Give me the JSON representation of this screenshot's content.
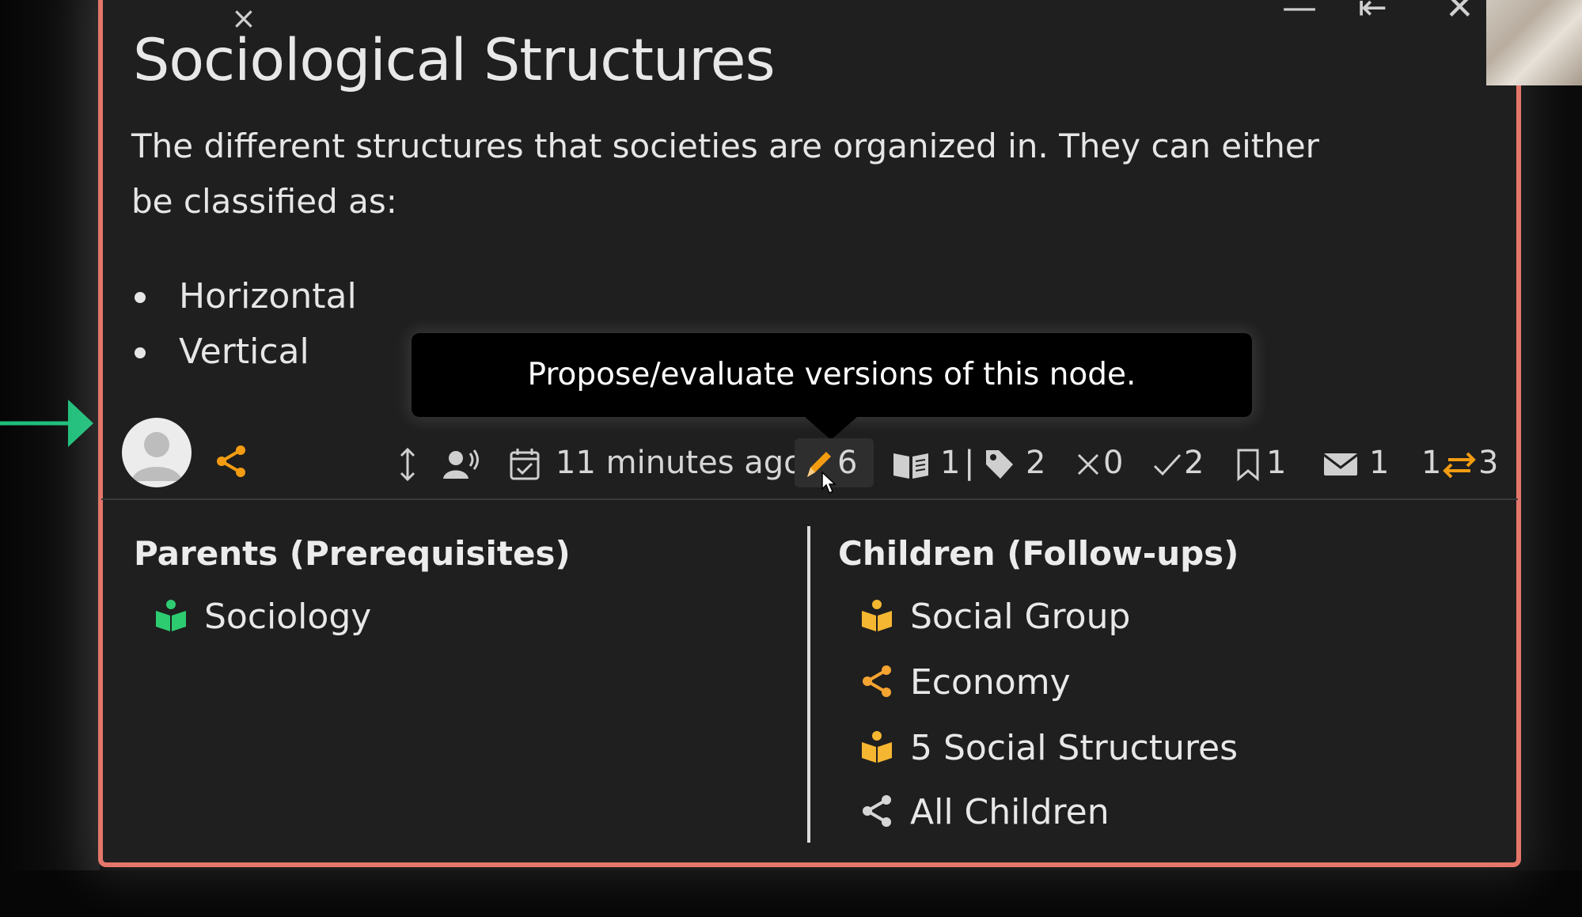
{
  "window": {
    "close_glyph": "×",
    "minimize_glyph": "—",
    "collapse_glyph": "⇤",
    "close_window_glyph": "✕"
  },
  "node": {
    "title": "Sociological Structures",
    "description": "The different structures that societies are organized in. They can either be classified as:",
    "bullets": [
      "Horizontal",
      "Vertical"
    ]
  },
  "tooltip": {
    "text": "Propose/evaluate versions of this node."
  },
  "toolbar": {
    "timestamp": "11 minutes ago",
    "versions_count": "6",
    "references_count": "1",
    "separator": "|",
    "tags_count": "2",
    "wrong_count": "0",
    "correct_count": "2",
    "bookmarks_count": "1",
    "messages_count": "1",
    "links_left": "1",
    "links_right": "3"
  },
  "parents": {
    "title": "Parents (Prerequisites)",
    "items": [
      {
        "label": "Sociology",
        "icon": "book-icon",
        "color": "#2ecc71"
      }
    ]
  },
  "children": {
    "title": "Children (Follow-ups)",
    "items": [
      {
        "label": "Social Group",
        "icon": "book-icon",
        "color": "#f5b731"
      },
      {
        "label": "Economy",
        "icon": "share-icon",
        "color": "#f5a431"
      },
      {
        "label": "5 Social Structures",
        "icon": "book-icon",
        "color": "#f5b731"
      },
      {
        "label": "All Children",
        "icon": "share-icon",
        "color": "#d6d6d6"
      }
    ]
  },
  "colors": {
    "card_border": "#e5766a",
    "accent_orange": "#f39c12",
    "accent_green": "#2ecc71",
    "card_bg": "#1f1f1f"
  }
}
